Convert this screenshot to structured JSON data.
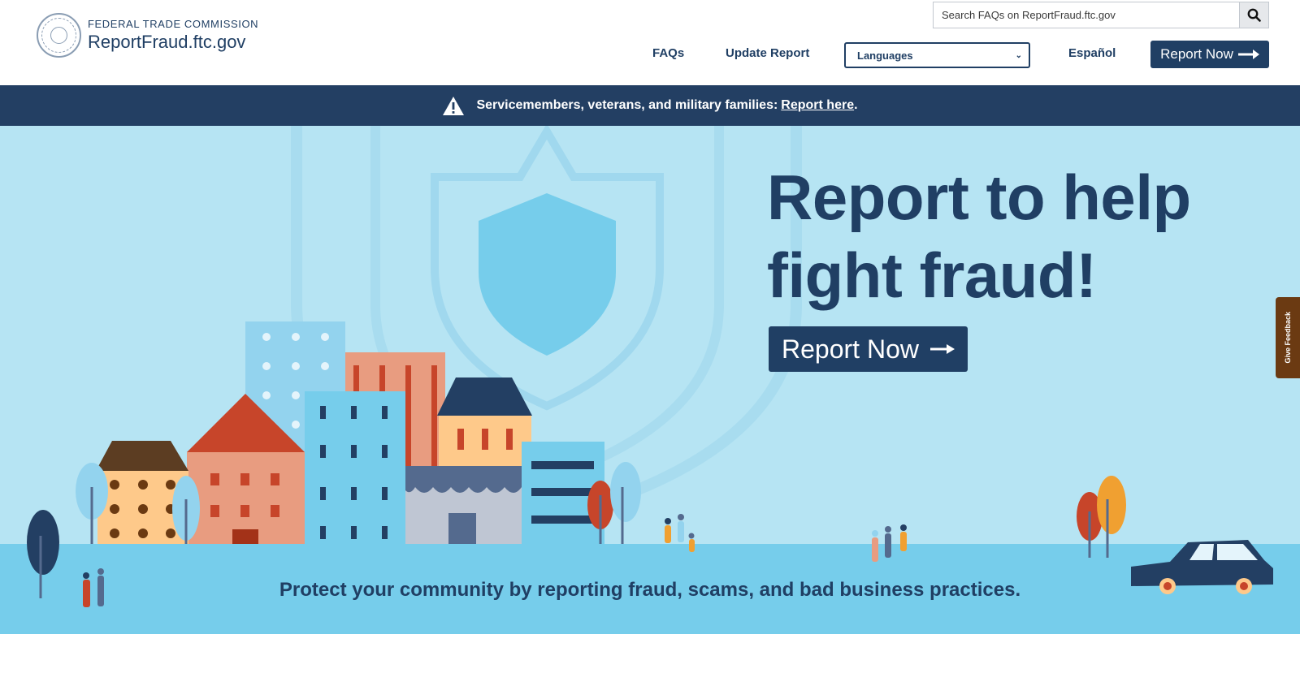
{
  "header": {
    "agency": "FEDERAL TRADE COMMISSION",
    "site": "ReportFraud.ftc.gov",
    "search_placeholder": "Search FAQs on ReportFraud.ftc.gov",
    "nav": {
      "faqs": "FAQs",
      "update": "Update Report",
      "languages": "Languages",
      "espanol": "Español",
      "report_now": "Report Now"
    }
  },
  "alert": {
    "text": "Servicemembers, veterans, and military families:",
    "link": "Report here",
    "period": "."
  },
  "hero": {
    "title_line1": "Report to help",
    "title_line2": "fight fraud!",
    "button": "Report Now",
    "tagline": "Protect your community by reporting fraud, scams, and bad business practices."
  },
  "feedback": "Give Feedback",
  "icons": {
    "search": "search-icon",
    "warning": "warning-icon",
    "arrow": "arrow-right-icon",
    "seal": "ftc-seal-icon"
  },
  "colors": {
    "navy": "#203f64",
    "sky": "#b6e4f3",
    "ground": "#76cdeb",
    "feedback": "#6b3a12"
  }
}
